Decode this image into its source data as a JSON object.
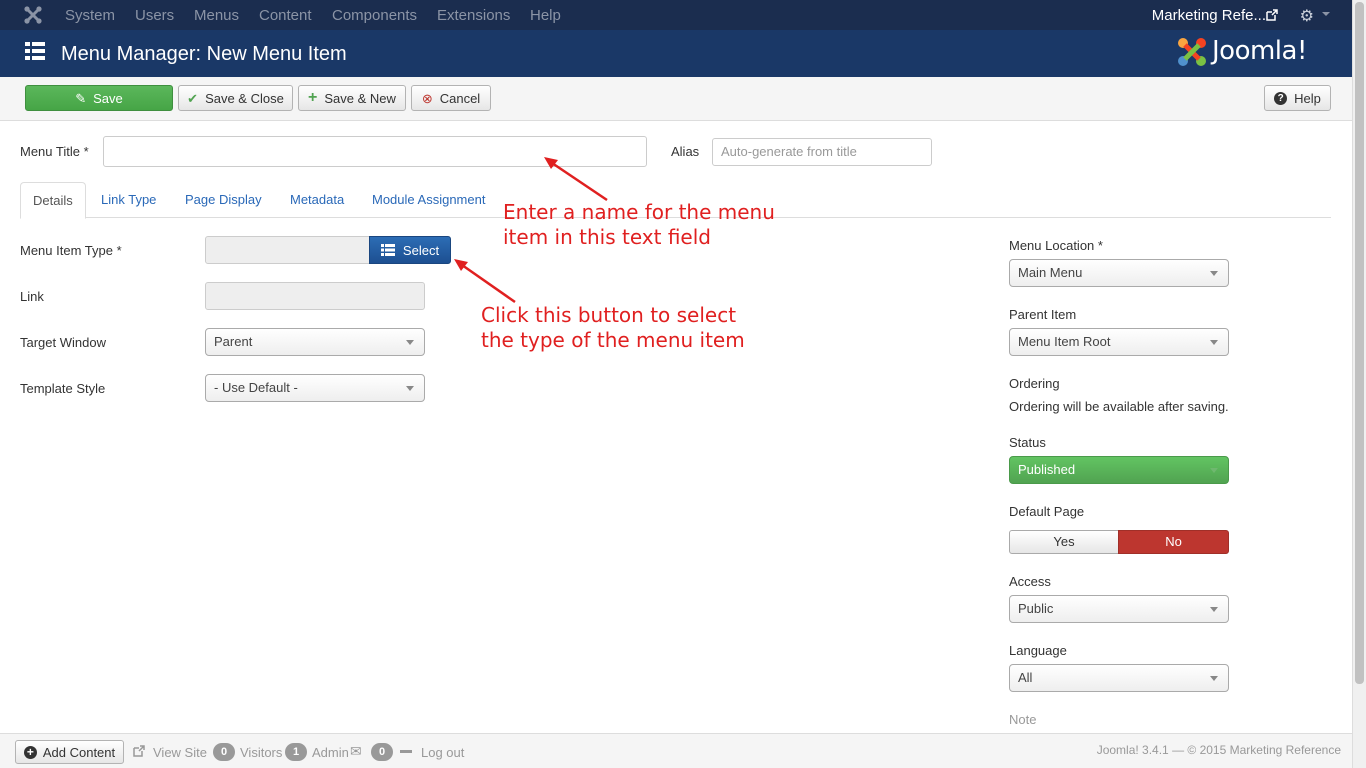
{
  "topnav": {
    "menu": [
      "System",
      "Users",
      "Menus",
      "Content",
      "Components",
      "Extensions",
      "Help"
    ],
    "site_name": "Marketing Refe..."
  },
  "header": {
    "title": "Menu Manager: New Menu Item",
    "brand": "Joomla!"
  },
  "toolbar": {
    "save": "Save",
    "save_close": "Save & Close",
    "save_new": "Save & New",
    "cancel": "Cancel",
    "help": "Help"
  },
  "form": {
    "menu_title_label": "Menu Title *",
    "menu_title_value": "",
    "alias_label": "Alias",
    "alias_placeholder": "Auto-generate from title"
  },
  "tabs": [
    "Details",
    "Link Type",
    "Page Display",
    "Metadata",
    "Module Assignment"
  ],
  "details": {
    "menu_item_type_label": "Menu Item Type *",
    "select_button": "Select",
    "link_label": "Link",
    "target_window_label": "Target Window",
    "target_window_value": "Parent",
    "template_style_label": "Template Style",
    "template_style_value": "- Use Default -"
  },
  "sidebar": {
    "menu_location_label": "Menu Location *",
    "menu_location_value": "Main Menu",
    "parent_item_label": "Parent Item",
    "parent_item_value": "Menu Item Root",
    "ordering_label": "Ordering",
    "ordering_note": "Ordering will be available after saving.",
    "status_label": "Status",
    "status_value": "Published",
    "default_page_label": "Default Page",
    "default_yes": "Yes",
    "default_no": "No",
    "access_label": "Access",
    "access_value": "Public",
    "language_label": "Language",
    "language_value": "All",
    "note_label": "Note"
  },
  "annotations": {
    "title_line1": "Enter a name for the menu",
    "title_line2": "item in this text field",
    "select_line1": "Click this button to select",
    "select_line2": "the type of the menu item"
  },
  "statusbar": {
    "add_content": "Add Content",
    "view_site": "View Site",
    "visitors_count": "0",
    "visitors_label": "Visitors",
    "admin_count": "1",
    "admin_label": "Admin",
    "messages_count": "0",
    "logout": "Log out",
    "copyright": "Joomla! 3.4.1  —  © 2015 Marketing Reference"
  },
  "colors": {
    "nav_bg": "#1b2d4f",
    "title_bg": "#1a3867",
    "save_green": "#5bb75b",
    "select_blue": "#1d4f91",
    "published_green": "#51a351",
    "no_red": "#bd362f",
    "annotation_red": "#e02020"
  }
}
